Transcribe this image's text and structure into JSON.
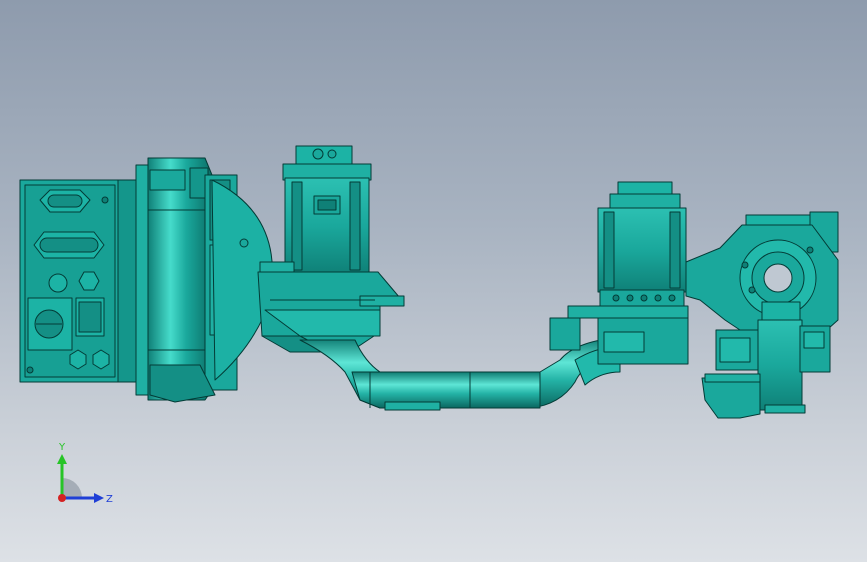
{
  "viewport": {
    "colors": {
      "background_top": "#8e9bad",
      "background_bottom": "#dde1e6",
      "model_fill": "#1aa89c",
      "model_light": "#3fd2c3",
      "model_dark": "#0a6b63",
      "edge": "#033b36"
    }
  },
  "triad": {
    "y_label": "Y",
    "z_label": "Z",
    "y_color": "#27c427",
    "z_color": "#1f3fd6",
    "x_color": "#d42222"
  }
}
